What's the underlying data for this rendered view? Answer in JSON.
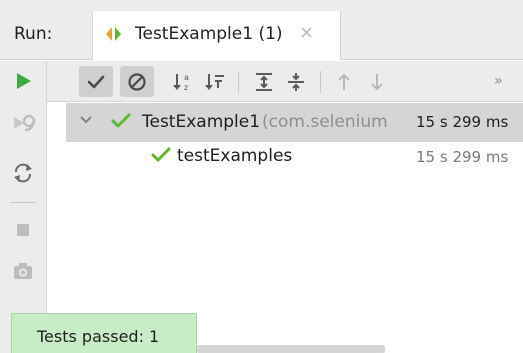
{
  "header": {
    "run_label": "Run:",
    "tab": {
      "title": "TestExample1 (1)",
      "icon": "run-config-icon",
      "close_icon": "close-icon",
      "close_glyph": "×"
    }
  },
  "left_toolbar": {
    "icons": [
      "run-icon",
      "rerun-failed-icon",
      "toggle-auto-test-icon",
      "stop-icon",
      "screenshot-icon"
    ]
  },
  "top_toolbar": {
    "icons": [
      "show-passed-icon",
      "show-ignored-icon",
      "sort-alphabetically-icon",
      "sort-by-duration-icon",
      "expand-all-icon",
      "collapse-all-icon",
      "previous-test-icon",
      "next-test-icon"
    ],
    "more_label": "»"
  },
  "tree": {
    "root": {
      "name": "TestExample1",
      "package": "(com.selenium",
      "duration": "15 s 299 ms",
      "status": "passed"
    },
    "children": [
      {
        "name": "testExamples",
        "duration": "15 s 299 ms",
        "status": "passed"
      }
    ]
  },
  "status_popup": {
    "text": "Tests passed: 1"
  },
  "colors": {
    "passed_green": "#5fb832",
    "run_green": "#3fa743",
    "toolbar_bg": "#ececec",
    "selected_row": "#d5d5d5",
    "popup_bg": "#c8ecc6"
  }
}
